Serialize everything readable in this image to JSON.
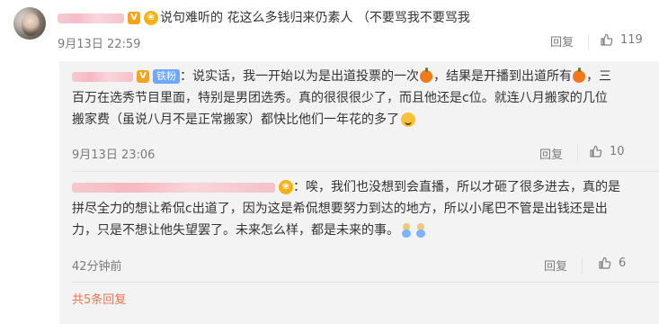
{
  "comment": {
    "text": "说句难听的 花这么多钱归来仍素人 （不要骂我不要骂我",
    "date": "9月13日 22:59",
    "reply_label": "回复",
    "likes": "119",
    "badge": "V"
  },
  "replies": [
    {
      "badge": "V",
      "fan_badge": "铁粉",
      "text_parts": [
        "：说实话，我一开始以为是出道投票的一次",
        "，结果是开播到出道所有",
        "，三百万在选秀节目里面，特别是男团选秀。真的很很很少了，而且他还是c位。就连八月搬家的几位搬家费（虽说八月不是正常搬家）都快比他们一年花的多了"
      ],
      "date": "9月13日 23:06",
      "reply_label": "回复",
      "likes": "10"
    },
    {
      "text": "：唉，我们也没想到会直播，所以才砸了很多进去，真的是拼尽全力的想让希侃c出道了，因为这是希侃想要努力到达的地方，所以小尾巴不管是出钱还是出力，只是不想让他失望罢了。未来怎么样，都是未来的事。",
      "date": "42分钟前",
      "reply_label": "回复",
      "likes": "6"
    }
  ],
  "footer": {
    "total_replies": "共5条回复"
  },
  "colors": {
    "accent": "#eb7350",
    "muted": "#7b7b7b",
    "reply_bg": "#f3f3f3"
  },
  "icons": [
    "thumbs-up-icon",
    "vip-badge-icon",
    "fan-badge-icon",
    "orange-emoji-icon",
    "laugh-cry-emoji-icon",
    "cheer-emoji-icon"
  ]
}
